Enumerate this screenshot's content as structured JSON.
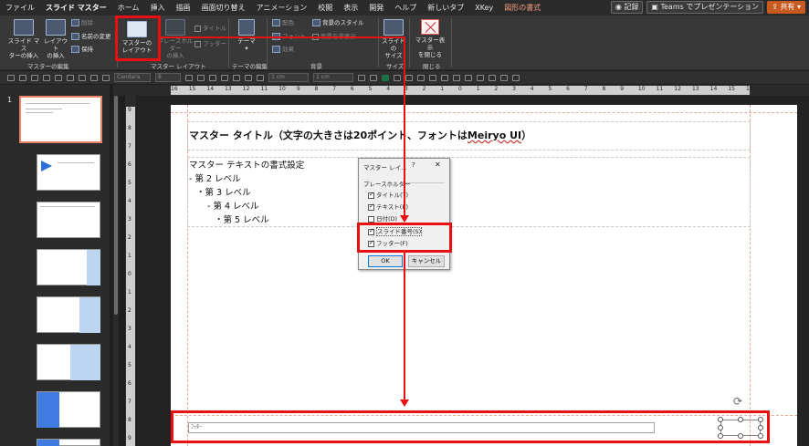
{
  "menu": {
    "tabs": [
      "ファイル",
      "スライド マスター",
      "ホーム",
      "挿入",
      "描画",
      "画面切り替え",
      "アニメーション",
      "校閲",
      "表示",
      "開発",
      "ヘルプ",
      "新しいタブ",
      "XKey",
      "図形の書式"
    ],
    "record": "記録",
    "teams": "Teams でプレゼンテーション",
    "share": "共有"
  },
  "ribbon": {
    "insert_master_l1": "スライド マス",
    "insert_master_l2": "ターの挿入",
    "insert_layout_l1": "レイアウト",
    "insert_layout_l2": "の挿入",
    "delete": "削除",
    "rename": "名前の変更",
    "preserve": "保持",
    "master_layout_l1": "マスターの",
    "master_layout_l2": "レイアウト",
    "placeholder_l1": "プレースホルダー",
    "placeholder_l2": "の挿入",
    "title_chk": "タイトル",
    "footer_chk": "フッター",
    "theme": "テーマ",
    "colors": "配色",
    "fonts": "フォント",
    "effects": "効果",
    "bg_style": "背景のスタイル",
    "hide_bg": "背景を非表示",
    "slide_size_l1": "スライドの",
    "slide_size_l2": "サイズ",
    "close_master_l1": "マスター表示",
    "close_master_l2": "を閉じる",
    "group_master_edit": "マスターの編集",
    "group_master_layout": "マスター レイアウト",
    "group_theme_edit": "テーマの編集",
    "group_background": "背景",
    "group_size": "サイズ",
    "group_close": "閉じる"
  },
  "quickbar": {
    "font_name": "Candara",
    "font_size": "8",
    "width": "1 cm",
    "height": "1 cm"
  },
  "thumbs": {
    "first_number": "1"
  },
  "ruler": {
    "h_ticks": [
      "16",
      "15",
      "14",
      "13",
      "12",
      "11",
      "10",
      "9",
      "8",
      "7",
      "6",
      "5",
      "4",
      "3",
      "2",
      "1",
      "0",
      "1",
      "2",
      "3",
      "4",
      "5",
      "6",
      "7",
      "8",
      "9",
      "10",
      "11",
      "12",
      "13",
      "14",
      "15",
      "16"
    ],
    "v_ticks": [
      "9",
      "8",
      "7",
      "6",
      "5",
      "4",
      "3",
      "2",
      "1",
      "0",
      "1",
      "2",
      "3",
      "4",
      "5",
      "6",
      "7",
      "8",
      "9"
    ]
  },
  "slide": {
    "title_prefix": "マスター タイトル（文字の大きさは20ポイント、フォントは",
    "title_font": "Meiryo UI",
    "title_suffix": "）",
    "body": [
      "マスター テキストの書式設定",
      "- 第 2 レベル",
      "・第 3 レベル",
      "- 第 4 レベル",
      "・第 5 レベル"
    ],
    "footer_label": "ﾌｯﾀｰ"
  },
  "dialog": {
    "title": "マスター レイ...",
    "help": "?",
    "close": "✕",
    "group": "プレースホルダー",
    "items": [
      {
        "label": "タイトル(T)",
        "checked": true
      },
      {
        "label": "テキスト(E)",
        "checked": true
      },
      {
        "label": "日付(D)",
        "checked": false
      },
      {
        "label": "スライド番号(S)",
        "checked": true
      },
      {
        "label": "フッター(F)",
        "checked": true
      }
    ],
    "ok": "OK",
    "cancel": "キャンセル"
  },
  "colors": {
    "annotation_red": "#e81010",
    "share_orange": "#c85a20",
    "selected_thumb": "#e8836a"
  }
}
